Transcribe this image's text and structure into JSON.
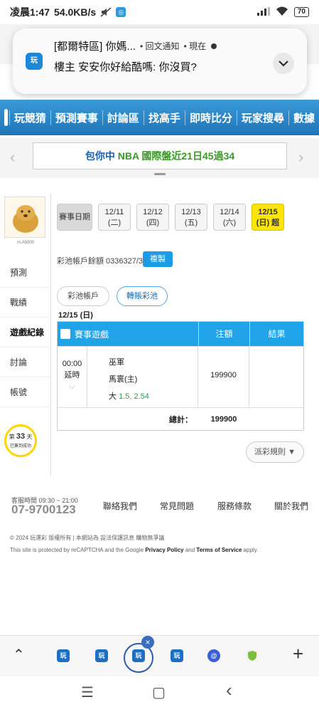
{
  "status_bar": {
    "time": "凌晨1:47",
    "speed": "54.0KB/s",
    "battery": "70"
  },
  "notification": {
    "app_icon_label": "玩",
    "title": "[都爾特區] 你媽...",
    "source": "• 回文通知",
    "when": "• 現在",
    "body": "樓主 安安你好給酷嗎: 你沒買?"
  },
  "nav": {
    "items": [
      "玩競猜",
      "預測賽事",
      "討論區",
      "找高手",
      "即時比分",
      "玩家搜尋",
      "數據"
    ]
  },
  "ticker": {
    "text_prefix": "包你中",
    "text_highlight": "NBA 國際盤近21日45過34"
  },
  "sidebar": {
    "avatar_label": "m.A5000",
    "items": [
      "預測",
      "戰績",
      "遊戲紀錄",
      "討論",
      "帳號"
    ],
    "active_index": 2,
    "bulb_line1": "第",
    "bulb_num": "33",
    "bulb_line2": "天",
    "bulb_line3": "已簽到成功"
  },
  "date_tabs": [
    {
      "l1": "賽事日期",
      "l2": ""
    },
    {
      "l1": "12/11",
      "l2": "(二)"
    },
    {
      "l1": "12/12",
      "l2": "(四)"
    },
    {
      "l1": "12/13",
      "l2": "(五)"
    },
    {
      "l1": "12/14",
      "l2": "(六)"
    },
    {
      "l1": "12/15",
      "l2": "(日) 超"
    }
  ],
  "account": {
    "label": "彩池帳戶餘額 0336327/3",
    "copy_button": "複製"
  },
  "sub_tabs": [
    "彩池帳戶",
    "轉賬彩池"
  ],
  "day_label": "12/15 (日)",
  "table": {
    "headers": [
      "賽事遊戲",
      "注額",
      "結果"
    ],
    "row": {
      "time": "00:00",
      "state": "延時",
      "chevron": "⌵",
      "team1": "巫軍",
      "team2": "馬寰(主)",
      "pick": "大",
      "odds": "1.5, 2.54",
      "amount": "199900",
      "result": ""
    },
    "total_label": "總計：",
    "total_value": "199900"
  },
  "rules_button": "派彩規則 ▼",
  "footer": {
    "hours": "客服時間 09:30 ~ 21:00",
    "phone": "07-9700123",
    "links": [
      "聯絡我們",
      "常見問題",
      "服務條款",
      "關於我們"
    ],
    "copyright": "© 2024 玩運彩 版權所有 | 本網站為 設法保護訊息 購物無爭議",
    "recaptcha_prefix": "This site is protected by reCAPTCHA and the Google",
    "privacy": "Privacy Policy",
    "and": "and",
    "terms": "Terms of Service",
    "apply": "apply."
  },
  "tabstrip": {
    "tab_label": "玩",
    "close": "×",
    "plus": "+",
    "up": "⌃"
  },
  "android_nav": {
    "menu": "☰",
    "home": "▢",
    "back": "‹"
  }
}
